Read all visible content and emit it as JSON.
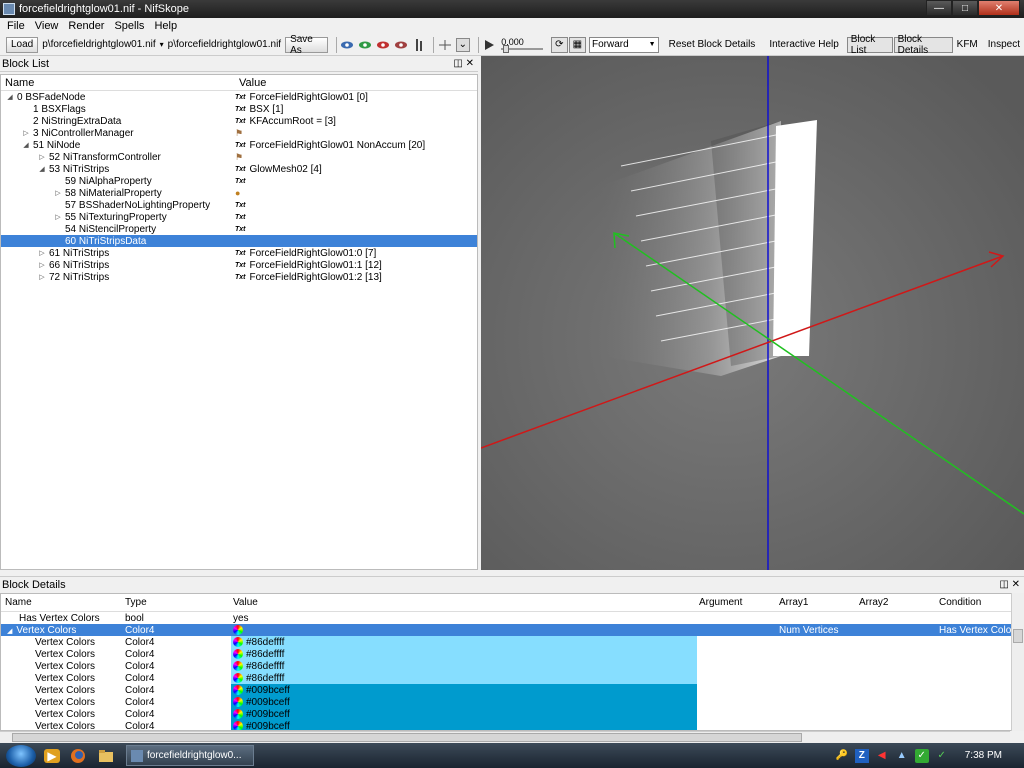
{
  "window": {
    "title": "forcefieldrightglow01.nif - NifSkope"
  },
  "menu": [
    "File",
    "View",
    "Render",
    "Spells",
    "Help"
  ],
  "toolbar": {
    "load_label": "Load",
    "load_path": "p\\forcefieldrightglow01.nif",
    "save_path": "p\\forcefieldrightglow01.nif",
    "save_as_label": "Save As",
    "slider_value": "0.000",
    "anim_mode": "Forward",
    "reset_label": "Reset Block Details",
    "help_label": "Interactive Help",
    "block_list_label": "Block List",
    "block_details_label": "Block Details",
    "kfm_label": "KFM",
    "inspect_label": "Inspect"
  },
  "block_list": {
    "title": "Block List",
    "col_name": "Name",
    "col_value": "Value",
    "rows": [
      {
        "depth": 0,
        "expander": "open",
        "name": "0 BSFadeNode",
        "badge": "Txt",
        "value": "ForceFieldRightGlow01 [0]"
      },
      {
        "depth": 1,
        "expander": "none",
        "name": "1 BSXFlags",
        "badge": "Txt",
        "value": "BSX [1]"
      },
      {
        "depth": 1,
        "expander": "none",
        "name": "2 NiStringExtraData",
        "badge": "Txt",
        "value": "KFAccumRoot =  [3]"
      },
      {
        "depth": 1,
        "expander": "closed",
        "name": "3 NiControllerManager",
        "badge": "flag",
        "value": ""
      },
      {
        "depth": 1,
        "expander": "open",
        "name": "51 NiNode",
        "badge": "Txt",
        "value": "ForceFieldRightGlow01 NonAccum [20]"
      },
      {
        "depth": 2,
        "expander": "closed",
        "name": "52 NiTransformController",
        "badge": "flag",
        "value": ""
      },
      {
        "depth": 2,
        "expander": "open",
        "name": "53 NiTriStrips",
        "badge": "Txt",
        "value": "GlowMesh02 [4]"
      },
      {
        "depth": 3,
        "expander": "none",
        "name": "59 NiAlphaProperty",
        "badge": "Txt",
        "value": ""
      },
      {
        "depth": 3,
        "expander": "closed",
        "name": "58 NiMaterialProperty",
        "badge": "paint",
        "value": ""
      },
      {
        "depth": 3,
        "expander": "none",
        "name": "57 BSShaderNoLightingProperty",
        "badge": "Txt",
        "value": ""
      },
      {
        "depth": 3,
        "expander": "closed",
        "name": "55 NiTexturingProperty",
        "badge": "Txt",
        "value": ""
      },
      {
        "depth": 3,
        "expander": "none",
        "name": "54 NiStencilProperty",
        "badge": "Txt",
        "value": ""
      },
      {
        "depth": 3,
        "expander": "none",
        "name": "60 NiTriStripsData",
        "badge": "",
        "value": "",
        "selected": true
      },
      {
        "depth": 2,
        "expander": "closed",
        "name": "61 NiTriStrips",
        "badge": "Txt",
        "value": "ForceFieldRightGlow01:0 [7]"
      },
      {
        "depth": 2,
        "expander": "closed",
        "name": "66 NiTriStrips",
        "badge": "Txt",
        "value": "ForceFieldRightGlow01:1 [12]"
      },
      {
        "depth": 2,
        "expander": "closed",
        "name": "72 NiTriStrips",
        "badge": "Txt",
        "value": "ForceFieldRightGlow01:2 [13]"
      }
    ]
  },
  "block_details": {
    "title": "Block Details",
    "columns": [
      "Name",
      "Type",
      "Value",
      "Argument",
      "Array1",
      "Array2",
      "Condition"
    ],
    "rows": [
      {
        "name": "Has Vertex Colors",
        "type": "bool",
        "value": "yes",
        "array1": "",
        "condition": "",
        "indent": 1,
        "fill": ""
      },
      {
        "name": "Vertex Colors",
        "type": "Color4",
        "value": "",
        "array1": "Num Vertices",
        "condition": "Has Vertex Color",
        "indent": 0,
        "selected": true,
        "fill": ""
      },
      {
        "name": "Vertex Colors",
        "type": "Color4",
        "value": "#86deffff",
        "indent": 2,
        "fill": "#86deff"
      },
      {
        "name": "Vertex Colors",
        "type": "Color4",
        "value": "#86deffff",
        "indent": 2,
        "fill": "#86deff"
      },
      {
        "name": "Vertex Colors",
        "type": "Color4",
        "value": "#86deffff",
        "indent": 2,
        "fill": "#86deff"
      },
      {
        "name": "Vertex Colors",
        "type": "Color4",
        "value": "#86deffff",
        "indent": 2,
        "fill": "#86deff"
      },
      {
        "name": "Vertex Colors",
        "type": "Color4",
        "value": "#009bceff",
        "indent": 2,
        "fill": "#009bce"
      },
      {
        "name": "Vertex Colors",
        "type": "Color4",
        "value": "#009bceff",
        "indent": 2,
        "fill": "#009bce"
      },
      {
        "name": "Vertex Colors",
        "type": "Color4",
        "value": "#009bceff",
        "indent": 2,
        "fill": "#009bce"
      },
      {
        "name": "Vertex Colors",
        "type": "Color4",
        "value": "#009bceff",
        "indent": 2,
        "fill": "#009bce"
      }
    ]
  },
  "taskbar": {
    "task_label": "forcefieldrightglow0...",
    "clock": "7:38 PM"
  },
  "colors": {
    "selection": "#3d82d8",
    "viewport_bg": "#6b6b6b"
  }
}
